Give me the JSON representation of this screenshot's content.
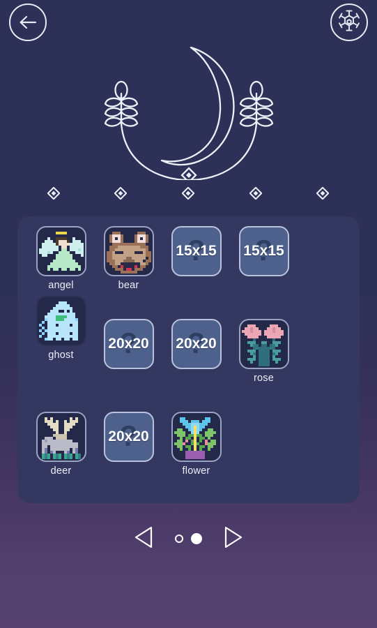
{
  "header": {
    "back_icon": "arrow-left-icon",
    "settings_icon": "hex-gear-icon",
    "emblem_icon": "crescent-moon-wheat-emblem"
  },
  "decoration": {
    "diamond_icon": "diamond-icon",
    "diamond_count": 5
  },
  "levels": [
    {
      "name": "angel",
      "state": "solved",
      "art": "angel",
      "size": ""
    },
    {
      "name": "bear",
      "state": "solved",
      "art": "bear",
      "size": ""
    },
    {
      "name": "",
      "state": "locked",
      "art": "",
      "size": "15x15"
    },
    {
      "name": "",
      "state": "locked",
      "art": "",
      "size": "15x15"
    },
    {
      "name": "ghost",
      "state": "solved",
      "art": "ghost",
      "size": ""
    },
    {
      "name": "",
      "state": "locked",
      "art": "",
      "size": "20x20"
    },
    {
      "name": "",
      "state": "locked",
      "art": "",
      "size": "20x20"
    },
    {
      "name": "rose",
      "state": "solved",
      "art": "rose",
      "size": ""
    },
    {
      "name": "deer",
      "state": "solved",
      "art": "deer",
      "size": ""
    },
    {
      "name": "",
      "state": "locked",
      "art": "",
      "size": "20x20"
    },
    {
      "name": "flower",
      "state": "solved",
      "art": "flower",
      "size": ""
    }
  ],
  "pager": {
    "prev_icon": "triangle-left-icon",
    "next_icon": "triangle-right-icon",
    "page_count": 2,
    "current_page": 2
  },
  "colors": {
    "background_top": "#2e3157",
    "background_bottom": "#56416f",
    "panel": "#343760",
    "tile_solved": "#252949",
    "tile_locked": "#4d618c",
    "stroke": "#e8eaf4",
    "label_text": "#eceef8"
  }
}
